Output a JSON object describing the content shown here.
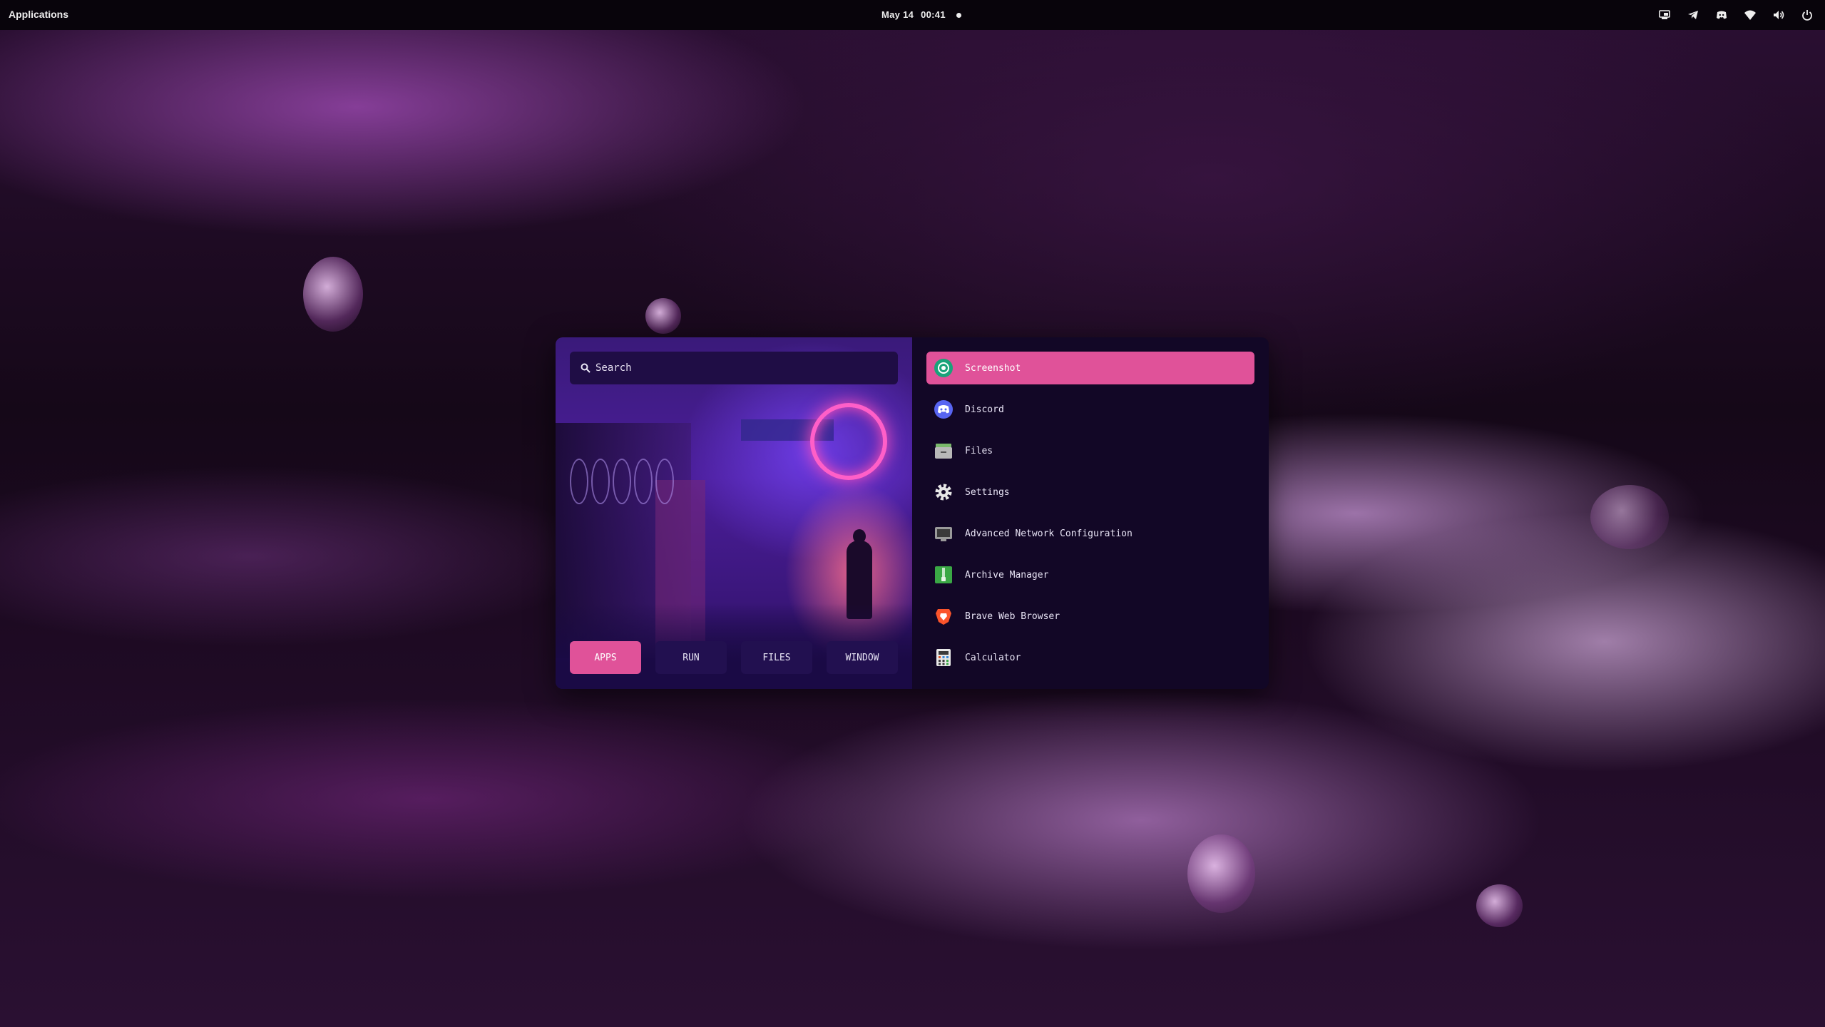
{
  "topbar": {
    "activities_label": "Applications",
    "date": "May 14",
    "time": "00:41",
    "tray_icons": [
      "screen-share-icon",
      "telegram-icon",
      "discord-icon",
      "wifi-icon",
      "volume-icon",
      "power-icon"
    ]
  },
  "launcher": {
    "search": {
      "placeholder": "Search",
      "value": ""
    },
    "modes": [
      {
        "label": "APPS",
        "active": true
      },
      {
        "label": "RUN",
        "active": false
      },
      {
        "label": "FILES",
        "active": false
      },
      {
        "label": "WINDOW",
        "active": false
      }
    ],
    "apps": [
      {
        "label": "Screenshot",
        "icon": "screenshot-icon",
        "selected": true
      },
      {
        "label": "Discord",
        "icon": "discord-icon"
      },
      {
        "label": "Files",
        "icon": "files-icon"
      },
      {
        "label": "Settings",
        "icon": "settings-icon"
      },
      {
        "label": "Advanced Network Configuration",
        "icon": "network-icon"
      },
      {
        "label": "Archive Manager",
        "icon": "archive-icon"
      },
      {
        "label": "Brave Web Browser",
        "icon": "brave-icon"
      },
      {
        "label": "Calculator",
        "icon": "calculator-icon"
      }
    ]
  },
  "colors": {
    "accent": "#e05299",
    "launcher_bg": "#120726",
    "button_bg": "#221050",
    "topbar_bg": "#08040b"
  }
}
